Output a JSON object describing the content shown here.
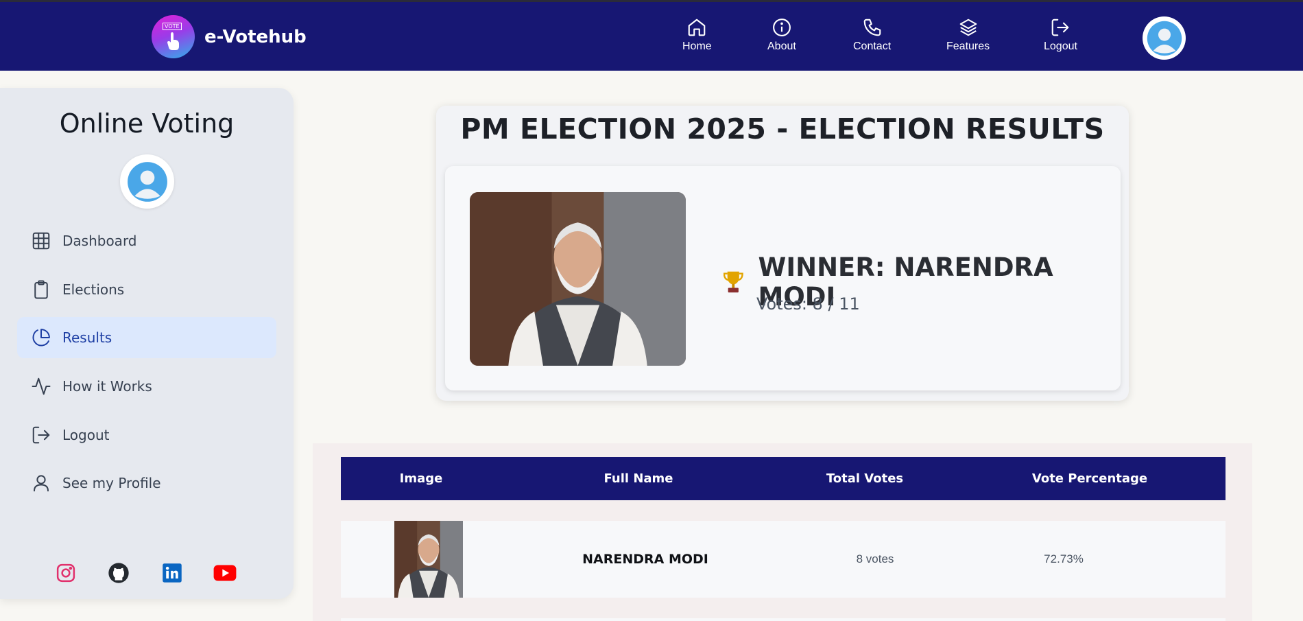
{
  "brand": {
    "name": "e-Votehub",
    "logo_tag": "VOTE"
  },
  "nav": {
    "items": [
      {
        "label": "Home",
        "icon": "home-icon"
      },
      {
        "label": "About",
        "icon": "info-icon"
      },
      {
        "label": "Contact",
        "icon": "phone-icon"
      },
      {
        "label": "Features",
        "icon": "layers-icon"
      },
      {
        "label": "Logout",
        "icon": "logout-icon"
      }
    ]
  },
  "sidebar": {
    "title": "Online Voting",
    "items": [
      {
        "label": "Dashboard",
        "icon": "grid-icon",
        "active": false
      },
      {
        "label": "Elections",
        "icon": "clipboard-icon",
        "active": false
      },
      {
        "label": "Results",
        "icon": "pie-chart-icon",
        "active": true
      },
      {
        "label": "How it Works",
        "icon": "activity-icon",
        "active": false
      },
      {
        "label": "Logout",
        "icon": "logout-icon",
        "active": false
      },
      {
        "label": "See my Profile",
        "icon": "user-icon",
        "active": false
      }
    ],
    "social": [
      {
        "name": "instagram-icon",
        "color": "#e1306c"
      },
      {
        "name": "github-icon",
        "color": "#24292f"
      },
      {
        "name": "linkedin-icon",
        "color": "#0a66c2"
      },
      {
        "name": "youtube-icon",
        "color": "#ff0000"
      }
    ]
  },
  "results": {
    "title": "PM ELECTION 2025 - ELECTION RESULTS",
    "winner_label": "WINNER: NARENDRA MODI",
    "winner_votes": "Votes: 8 / 11"
  },
  "table": {
    "headers": [
      "Image",
      "Full Name",
      "Total Votes",
      "Vote Percentage"
    ],
    "rows": [
      {
        "name": "NARENDRA MODI",
        "votes": "8 votes",
        "percentage": "72.73%"
      }
    ]
  },
  "colors": {
    "navy": "#171773",
    "active_bg": "#dce8fd",
    "active_text": "#1e3fa4"
  }
}
